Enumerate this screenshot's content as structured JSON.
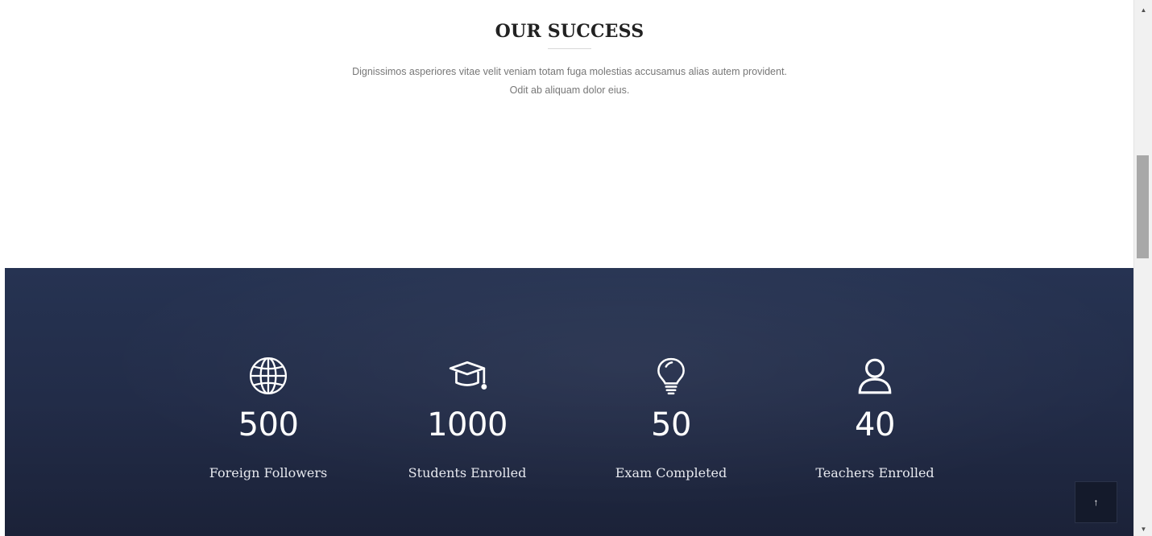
{
  "success": {
    "title": "OUR SUCCESS",
    "subtitle": "Dignissimos asperiores vitae velit veniam totam fuga molestias accusamus alias autem provident. Odit ab aliquam dolor eius."
  },
  "counters": [
    {
      "icon": "globe-icon",
      "value": "500",
      "label": "Foreign Followers"
    },
    {
      "icon": "graduation-cap-icon",
      "value": "1000",
      "label": "Students Enrolled"
    },
    {
      "icon": "lightbulb-icon",
      "value": "50",
      "label": "Exam Completed"
    },
    {
      "icon": "user-icon",
      "value": "40",
      "label": "Teachers Enrolled"
    }
  ],
  "back_to_top": {
    "icon": "arrow-up-icon",
    "glyph": "↑"
  },
  "colors": {
    "band_top": "#263352",
    "band_bottom": "#1b2238",
    "text_light": "#ffffff",
    "subtitle_gray": "#777777"
  }
}
